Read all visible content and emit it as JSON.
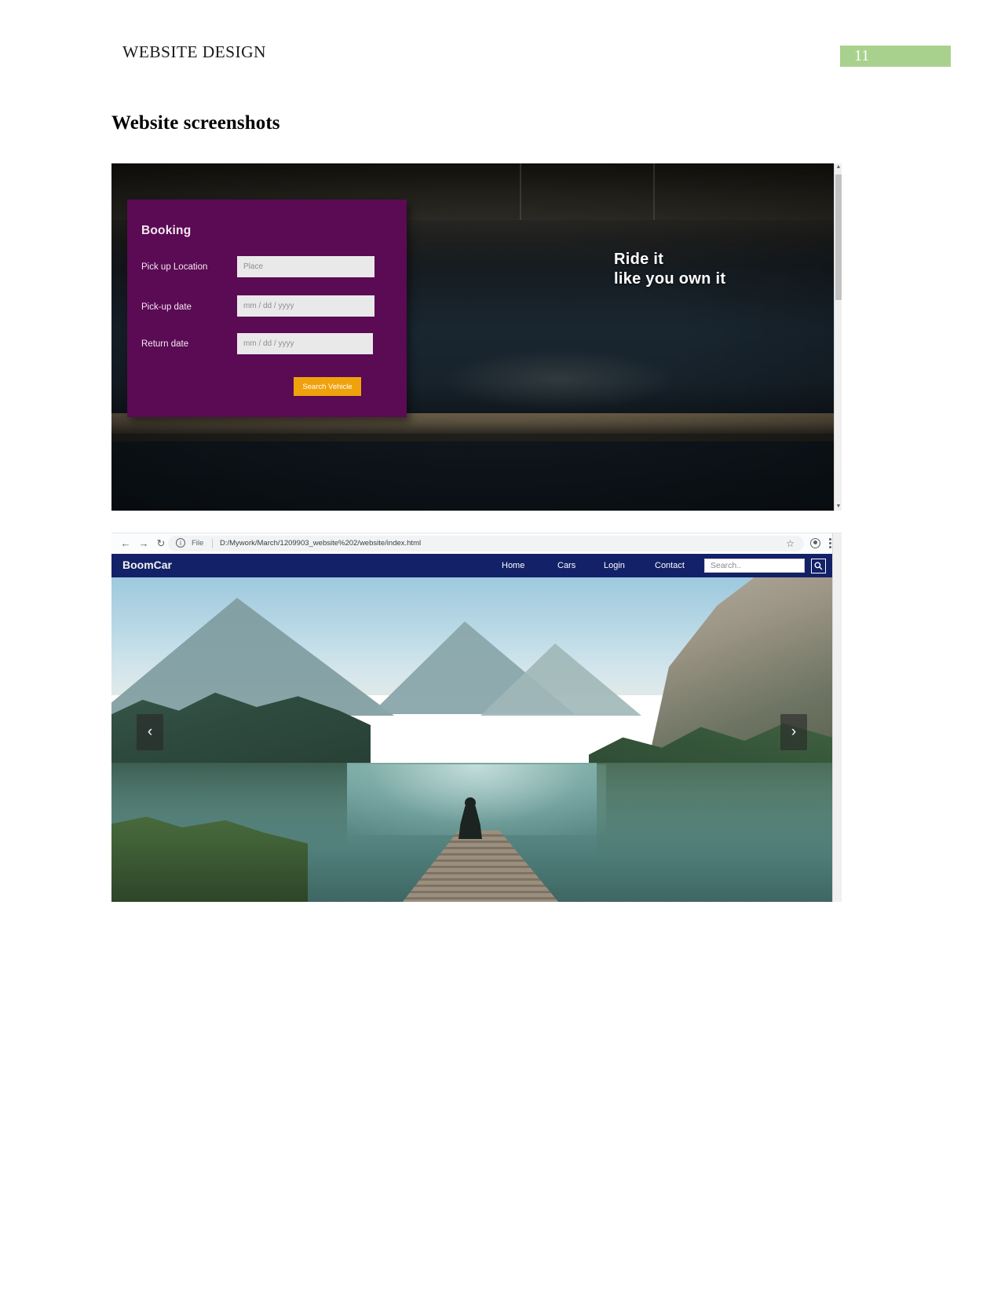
{
  "document": {
    "running_header": "WEBSITE DESIGN",
    "page_number": "11",
    "page_number_bg": "#a9d18e",
    "section_heading": "Website screenshots"
  },
  "screenshot_hero": {
    "booking": {
      "title": "Booking",
      "fields": [
        {
          "label": "Pick up Location",
          "placeholder": "Place",
          "value": ""
        },
        {
          "label": "Pick-up date",
          "placeholder": "mm / dd / yyyy",
          "value": ""
        },
        {
          "label": "Return date",
          "placeholder": "mm / dd / yyyy",
          "value": ""
        }
      ],
      "submit_label": "Search Vehicle",
      "card_color": "#5b0a54",
      "button_color": "#f0a20c"
    },
    "headline": {
      "line1": "Ride it",
      "line2": "like you own it"
    },
    "scrollbar": {
      "up_arrow": "▲",
      "down_arrow": "▼"
    }
  },
  "screenshot_browser": {
    "toolbar": {
      "back_icon": "←",
      "forward_icon": "→",
      "reload_icon": "↻",
      "info_icon": "i",
      "scheme_label": "File",
      "url": "D:/Mywork/March/1209903_website%202/website/index.html",
      "star_icon": "☆"
    },
    "site": {
      "logo": "BoomCar",
      "nav_links": [
        "Home",
        "Cars",
        "Login",
        "Contact"
      ],
      "search_placeholder": "Search..",
      "search_value": "",
      "search_icon": "⌕",
      "navbar_color": "#132168"
    },
    "carousel": {
      "prev_label": "‹",
      "next_label": "›"
    }
  }
}
